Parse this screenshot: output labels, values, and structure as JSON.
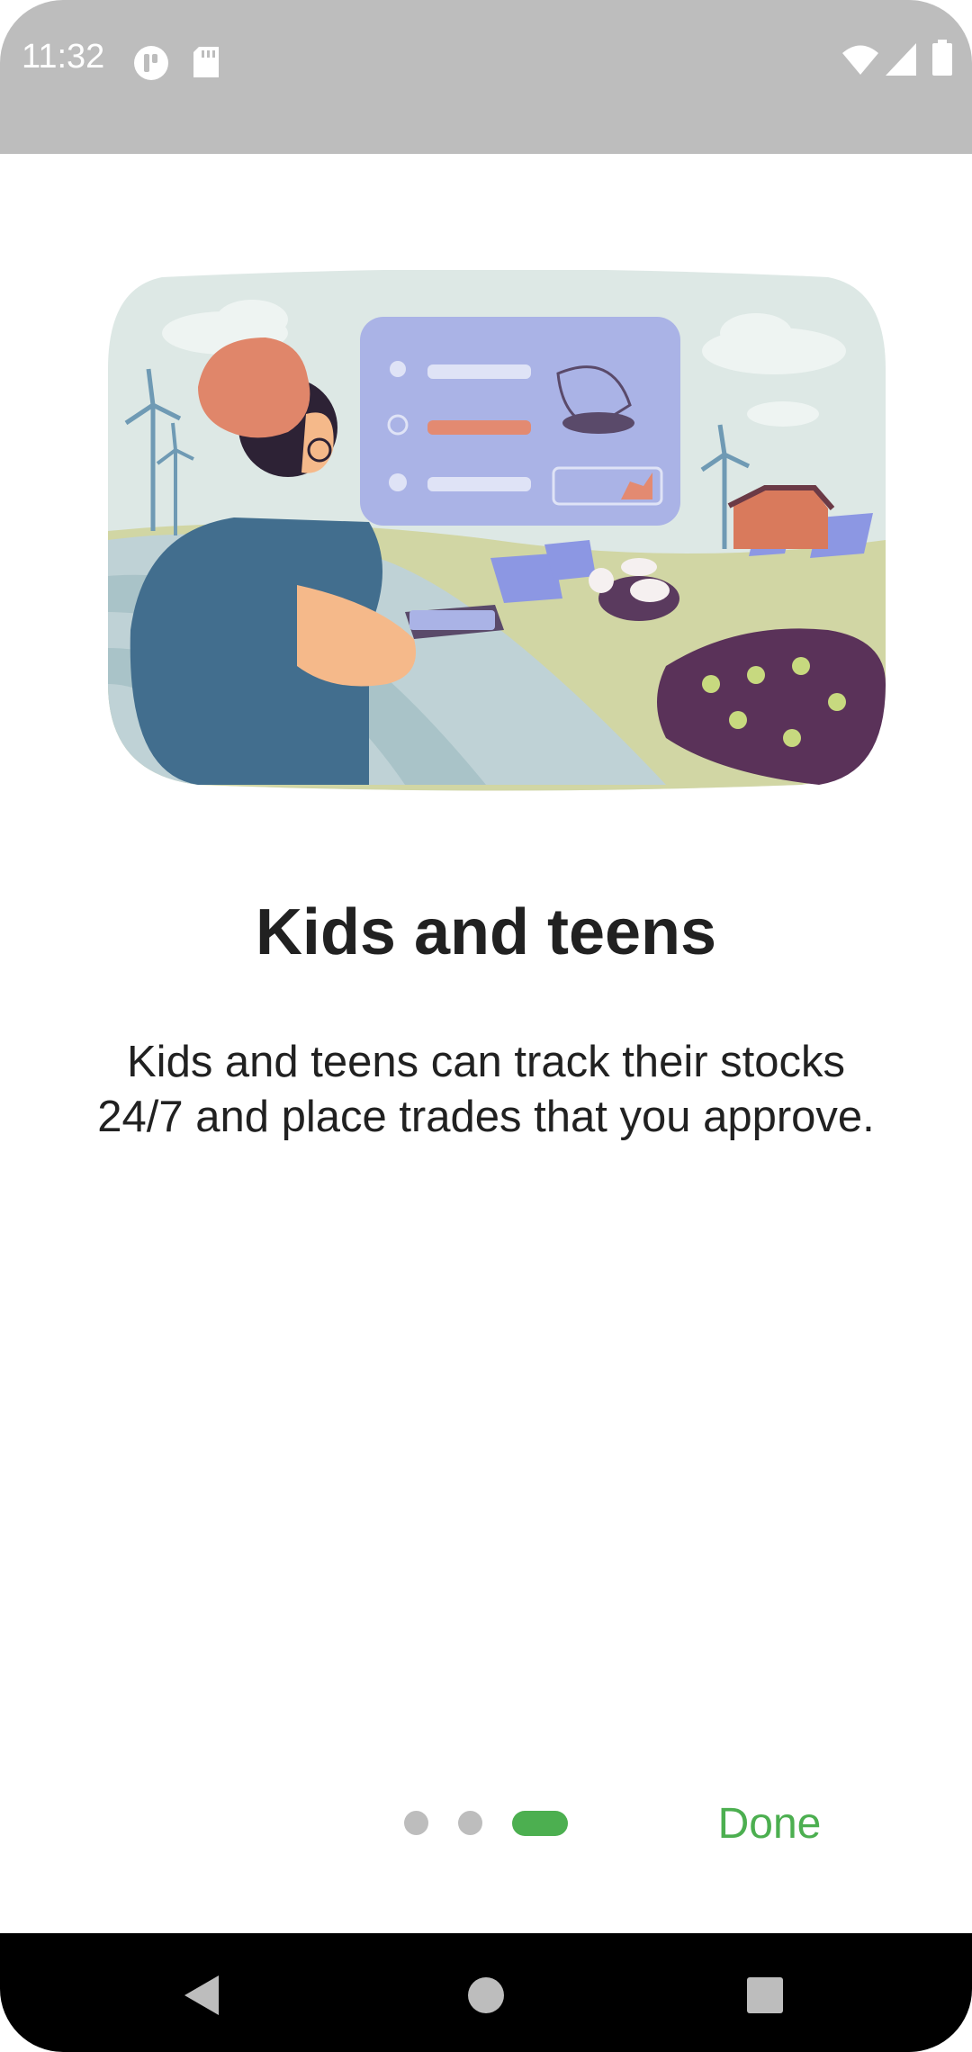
{
  "status_bar": {
    "time": "11:32",
    "icons": [
      "app-notification-icon",
      "sd-card-icon",
      "wifi-icon",
      "signal-icon",
      "battery-icon"
    ]
  },
  "onboarding": {
    "illustration": "smart-farm-illustration",
    "title": "Kids and teens",
    "description": "Kids and teens can track their stocks 24/7 and place trades that you approve.",
    "page_indicator": {
      "total": 3,
      "current": 3
    },
    "done_label": "Done"
  },
  "navigation_bar": {
    "icons": [
      "back-icon",
      "home-icon",
      "recents-icon"
    ]
  },
  "colors": {
    "accent": "#4caf50",
    "status_bar": "#bdbdbd",
    "text": "#212121",
    "indicator_inactive": "#bdbdbd"
  }
}
